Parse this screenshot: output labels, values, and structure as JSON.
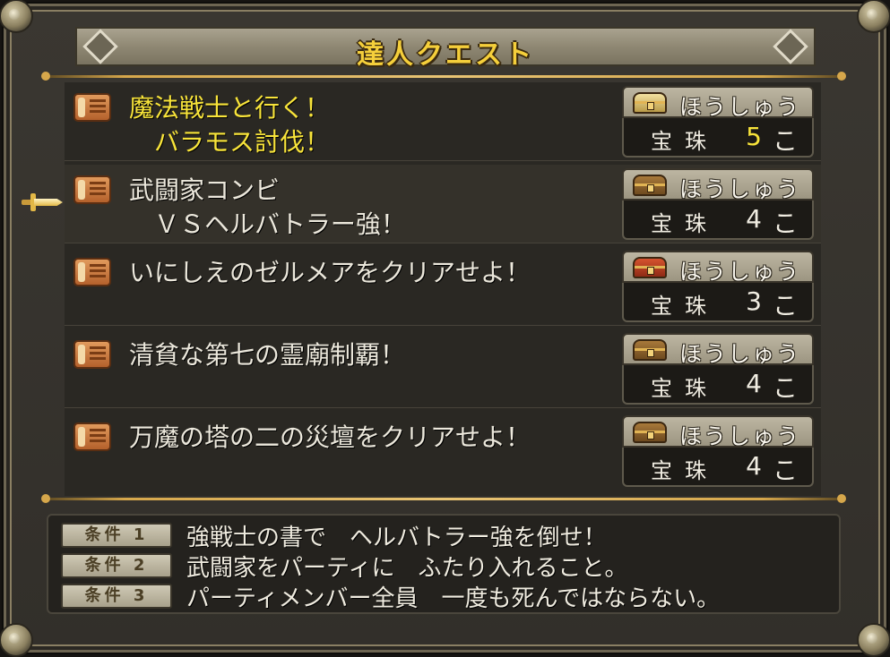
{
  "title": "達人クエスト",
  "quests": [
    {
      "name": "魔法戦士と行く！\n　バラモス討伐！",
      "highlight": true,
      "selected": false,
      "reward_label": "ほうしゅう",
      "reward_item": "宝珠",
      "reward_count": "5",
      "reward_unit": "こ",
      "chest": "gold-chest-icon"
    },
    {
      "name": "武闘家コンビ\n　ＶＳヘルバトラー強！",
      "highlight": false,
      "selected": true,
      "reward_label": "ほうしゅう",
      "reward_item": "宝珠",
      "reward_count": "4",
      "reward_unit": "こ",
      "chest": "chest-icon"
    },
    {
      "name": "いにしえのゼルメアをクリアせよ！",
      "highlight": false,
      "selected": false,
      "reward_label": "ほうしゅう",
      "reward_item": "宝珠",
      "reward_count": "3",
      "reward_unit": "こ",
      "chest": "red-chest-icon"
    },
    {
      "name": "清貧な第七の霊廟制覇！",
      "highlight": false,
      "selected": false,
      "reward_label": "ほうしゅう",
      "reward_item": "宝珠",
      "reward_count": "4",
      "reward_unit": "こ",
      "chest": "chest-icon"
    },
    {
      "name": "万魔の塔の二の災壇をクリアせよ！",
      "highlight": false,
      "selected": false,
      "reward_label": "ほうしゅう",
      "reward_item": "宝珠",
      "reward_count": "4",
      "reward_unit": "こ",
      "chest": "chest-icon"
    }
  ],
  "conditions": [
    {
      "badge": "条件 1",
      "text": "強戦士の書で　ヘルバトラー強を倒せ！"
    },
    {
      "badge": "条件 2",
      "text": "武闘家をパーティに　ふたり入れること。"
    },
    {
      "badge": "条件 3",
      "text": "パーティメンバー全員　一度も死んではならない。"
    }
  ],
  "colors": {
    "title": "#f5cf3b",
    "highlight_text": "#f8e43a",
    "normal_text": "#ece8dc",
    "panel_bg": "#2a2823",
    "frame": "#6d6552"
  }
}
